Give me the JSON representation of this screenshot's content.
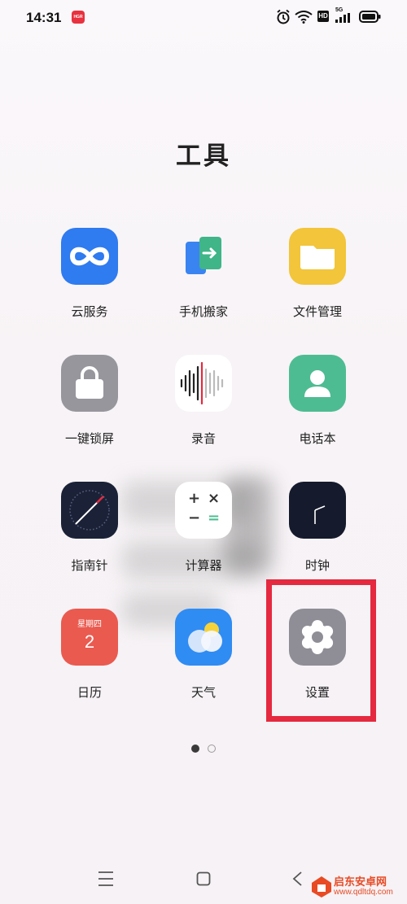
{
  "status_bar": {
    "time": "14:31",
    "app_badge": "HGR",
    "hd": "HD",
    "network": "5G",
    "icons": [
      "alarm-icon",
      "wifi-icon",
      "hd-icon",
      "signal-icon",
      "battery-icon"
    ]
  },
  "folder": {
    "title": "工具",
    "apps": [
      {
        "label": "云服务",
        "icon": "cloud-service-icon",
        "color": "#2f7bf0"
      },
      {
        "label": "手机搬家",
        "icon": "phone-clone-icon",
        "color": "#3fb588"
      },
      {
        "label": "文件管理",
        "icon": "file-manager-icon",
        "color": "#f2c53a"
      },
      {
        "label": "一键锁屏",
        "icon": "lock-screen-icon",
        "color": "#97969d"
      },
      {
        "label": "录音",
        "icon": "recorder-icon",
        "color": "#ffffff"
      },
      {
        "label": "电话本",
        "icon": "contacts-icon",
        "color": "#4ebc92"
      },
      {
        "label": "指南针",
        "icon": "compass-icon",
        "color": "#1b2237"
      },
      {
        "label": "计算器",
        "icon": "calculator-icon",
        "color": "#ffffff"
      },
      {
        "label": "时钟",
        "icon": "clock-icon",
        "color": "#151a2c"
      },
      {
        "label": "日历",
        "icon": "calendar-icon",
        "color": "#ea5a4f",
        "weekday": "星期四",
        "day": "2"
      },
      {
        "label": "天气",
        "icon": "weather-icon",
        "color": "#2f8cf3"
      },
      {
        "label": "设置",
        "icon": "settings-icon",
        "color": "#8f8e96"
      }
    ],
    "calculator_symbols": [
      "+",
      "×",
      "−",
      "="
    ],
    "highlight_color": "#e5293f"
  },
  "pagination": {
    "pages": 2,
    "current": 1
  },
  "nav_bar": {
    "buttons": [
      "menu-icon",
      "home-icon",
      "back-icon"
    ]
  },
  "watermark": {
    "name": "启东安卓网",
    "url": "www.qdltdq.com"
  }
}
